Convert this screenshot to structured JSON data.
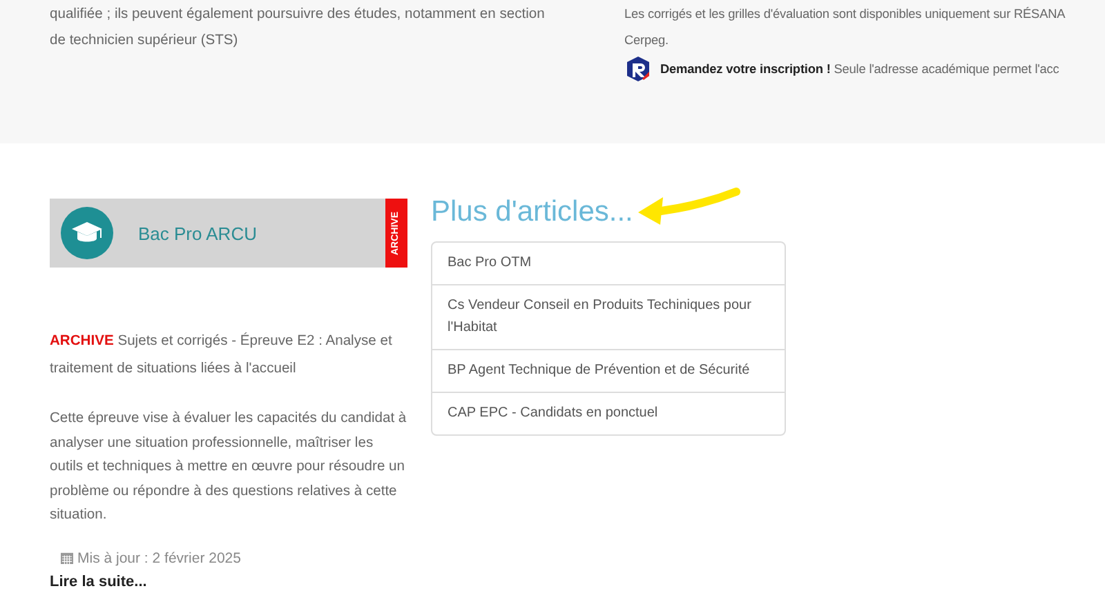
{
  "top_band": {
    "left_text": "qualifiée ; ils peuvent également poursuivre des études, notamment en section de technicien supérieur (STS)",
    "right_lines": [
      "Les corrigés et les grilles d'évaluation sont disponibles uniquement sur RÉSANA",
      "Cerpeg."
    ],
    "notice": "**Demandez votre inscription !** Seule l'adresse académique permet l'acc"
  },
  "card": {
    "title": "Bac Pro ARCU",
    "ribbon": "ARCHIVE"
  },
  "article": {
    "title": "**ARCHIVE** Sujets et corrigés - Épreuve E2 : Analyse et traitement de situations liées à l'accueil",
    "description": "Cette épreuve vise à évaluer les capacités du candidat à analyser une situation professionnelle, maîtriser les outils et techniques à mettre en œuvre pour résoudre un problème ou répondre à des questions relatives à cette situation.",
    "date": "Mis à jour : 2 février 2025",
    "read_more": "Lire la suite..."
  },
  "more_articles": {
    "heading": "Plus d'articles...",
    "items": [
      "Bac Pro OTM",
      "Cs Vendeur Conseil en Produits Techiniques pour l'Habitat",
      "BP Agent Technique de Prévention et de Sécurité",
      "CAP EPC - Candidats en ponctuel"
    ]
  }
}
